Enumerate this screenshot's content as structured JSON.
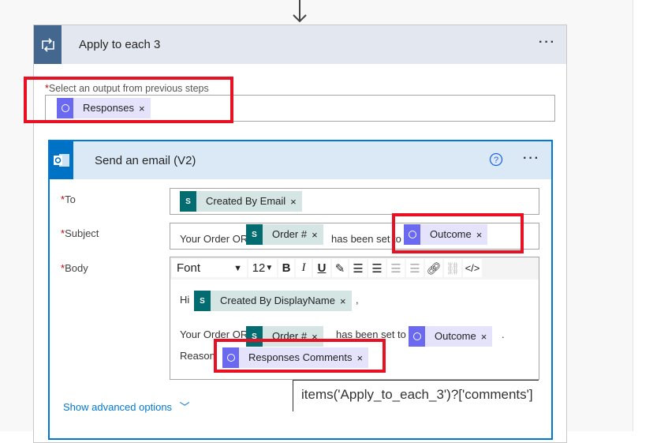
{
  "outer_action": {
    "title": "Apply to each 3",
    "more_label": "···",
    "field_label": "Select an output from previous steps",
    "required_mark": "*",
    "token": {
      "label": "Responses",
      "remove": "×",
      "source": "forms"
    }
  },
  "inner_action": {
    "title": "Send an email (V2)",
    "help_icon": "question-circle-icon",
    "more_label": "···",
    "fields": {
      "to": {
        "label": "To",
        "required_mark": "*",
        "tokens": [
          {
            "label": "Created By Email",
            "remove": "×",
            "source": "sharepoint"
          }
        ]
      },
      "subject": {
        "label": "Subject",
        "required_mark": "*",
        "text_before": "Your Order OR",
        "token1": {
          "label": "Order #",
          "remove": "×",
          "source": "sharepoint"
        },
        "text_middle": "has been set to",
        "token2": {
          "label": "Outcome",
          "remove": "×",
          "source": "forms"
        }
      },
      "body": {
        "label": "Body",
        "required_mark": "*",
        "toolbar": {
          "font": "Font",
          "size": "12",
          "bold": "B",
          "italic": "I",
          "underline": "U"
        },
        "line1": {
          "text": "Hi",
          "token": {
            "label": "Created By DisplayName",
            "remove": "×"
          },
          "suffix": ","
        },
        "line2": {
          "text": "Your Order OR",
          "token1": {
            "label": "Order #",
            "remove": "×"
          },
          "text_middle": "has been set to",
          "token2": {
            "label": "Outcome",
            "remove": "×"
          },
          "suffix": "."
        },
        "line3": {
          "text": "Reason",
          "token": {
            "label": "Responses Comments",
            "remove": "×"
          }
        }
      }
    },
    "show_advanced": "Show advanced options",
    "tooltip": "items('Apply_to_each_3')?['comments']"
  },
  "colors": {
    "highlight": "#e81123",
    "accent": "#0078d4",
    "sharepoint": "#036c70",
    "forms": "#6b69f0"
  }
}
